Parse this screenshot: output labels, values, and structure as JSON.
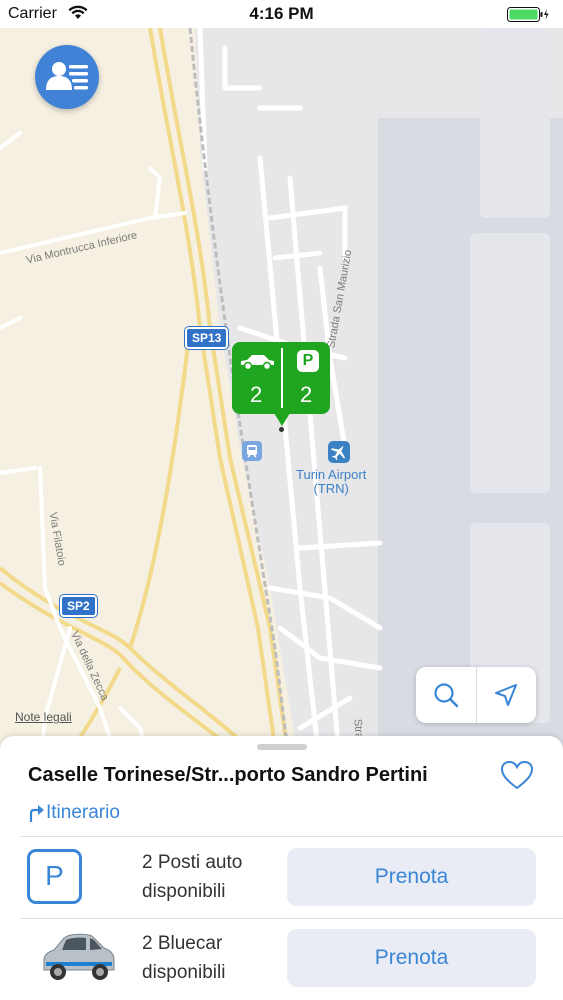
{
  "status_bar": {
    "carrier": "Carrier",
    "time": "4:16 PM"
  },
  "map": {
    "street_labels": [
      "Via Montrucca Inferiore",
      "Strada San Maurizio",
      "Via Filatoio",
      "Via della Zecca",
      "Stra"
    ],
    "road_shields": [
      "SP13",
      "SP2"
    ],
    "airport_name": "Turin Airport",
    "airport_code": "(TRN)",
    "legal_link": "Note legali",
    "marker": {
      "cars_available": "2",
      "parking_available": "2",
      "parking_letter": "P",
      "color": "#1fa51f"
    }
  },
  "sheet": {
    "station_title": "Caselle Torinese/Str...porto Sandro Pertini",
    "itinerary_label": "Itinerario",
    "rows": [
      {
        "line1": "2 Posti auto",
        "line2": "disponibili",
        "button": "Prenota",
        "icon": "parking-icon"
      },
      {
        "line1": "2 Bluecar",
        "line2": "disponibili",
        "button": "Prenota",
        "icon": "bluecar-image"
      }
    ],
    "parking_letter": "P"
  },
  "colors": {
    "accent": "#3a86d6",
    "profile_button": "#3f82d6",
    "button_bg": "#e9ecf5"
  }
}
